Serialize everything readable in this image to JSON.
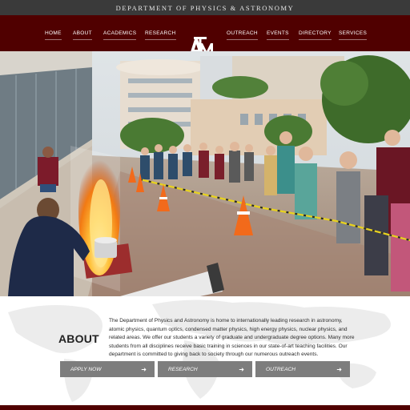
{
  "header": {
    "department_title": "DEPARTMENT OF PHYSICS & ASTRONOMY"
  },
  "nav": {
    "items": [
      {
        "label": "HOME"
      },
      {
        "label": "ABOUT"
      },
      {
        "label": "ACADEMICS"
      },
      {
        "label": "RESEARCH"
      },
      {
        "label": "OUTREACH"
      },
      {
        "label": "EVENTS"
      },
      {
        "label": "DIRECTORY"
      },
      {
        "label": "SERVICES"
      }
    ],
    "logo_text": "ATM",
    "logo_icon": "tamu-logo-icon"
  },
  "hero": {
    "image_subject": "outreach fire demonstration photo"
  },
  "about": {
    "heading": "ABOUT",
    "body": "The Department of Physics and Astronomy is home to internationally leading research in astronomy, atomic physics, quantum optics, condensed matter physics, high energy physics, nuclear physics, and related areas. We offer our students a variety of graduate and undergraduate degree options. Many more students from all disciplines receive basic training in sciences in our state-of-art teaching facilities. Our department is committed to giving back to society through our numerous outreach events.",
    "buttons": [
      {
        "label": "APPLY NOW",
        "icon": "arrow-right-icon"
      },
      {
        "label": "RESEARCH",
        "icon": "arrow-right-icon"
      },
      {
        "label": "OUTREACH",
        "icon": "arrow-right-icon"
      }
    ]
  },
  "colors": {
    "maroon": "#500000",
    "topbar": "#3a3a3a",
    "button_gray": "#7d7d7d"
  }
}
